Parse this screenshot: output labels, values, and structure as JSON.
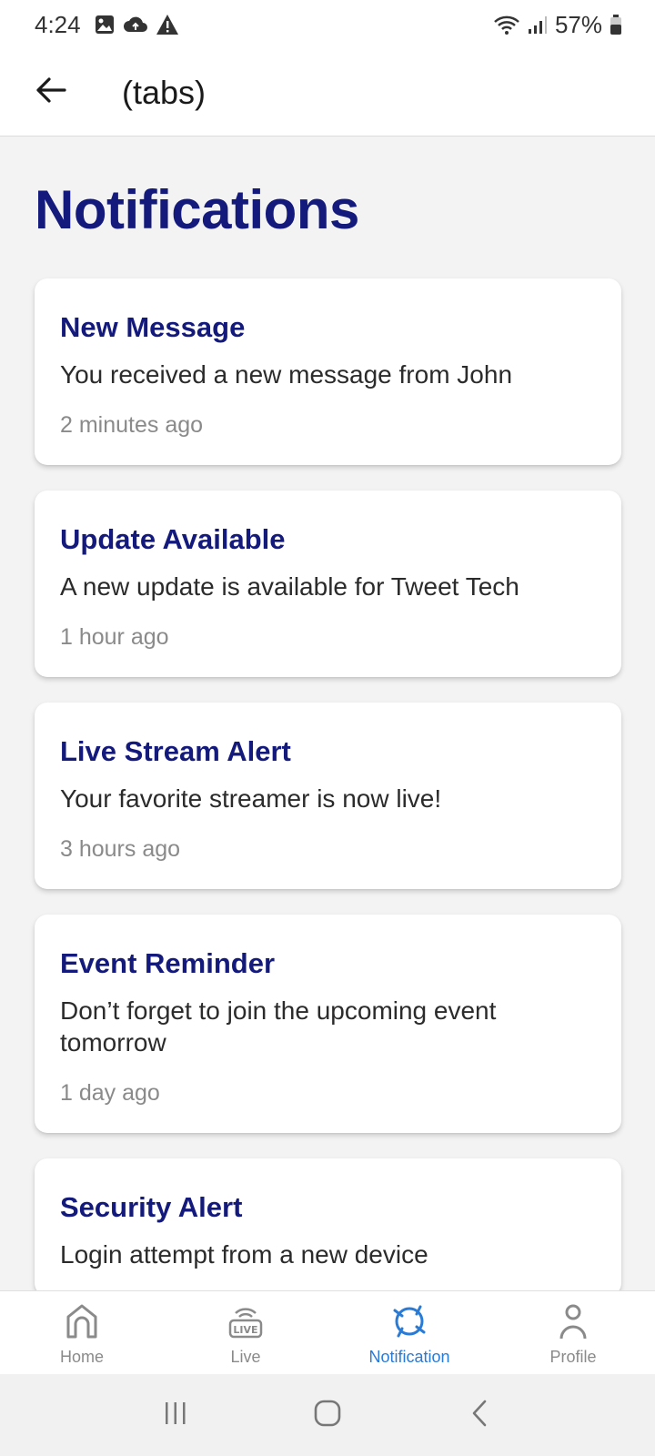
{
  "status_bar": {
    "time": "4:24",
    "battery": "57%",
    "icons_left": [
      "image-icon",
      "cloud-icon",
      "warning-icon"
    ],
    "icons_right": [
      "wifi-icon",
      "signal-icon",
      "battery-icon"
    ]
  },
  "app_bar": {
    "title": "(tabs)",
    "back_icon": "back-arrow-icon"
  },
  "page": {
    "title": "Notifications"
  },
  "notifications": [
    {
      "title": "New Message",
      "body": "You received a new message from John",
      "time": "2 minutes ago"
    },
    {
      "title": "Update Available",
      "body": "A new update is available for Tweet Tech",
      "time": "1 hour ago"
    },
    {
      "title": "Live Stream Alert",
      "body": "Your favorite streamer is now live!",
      "time": "3 hours ago"
    },
    {
      "title": "Event Reminder",
      "body": "Don’t forget to join the upcoming event tomorrow",
      "time": "1 day ago"
    },
    {
      "title": "Security Alert",
      "body": "Login attempt from a new device",
      "time": ""
    }
  ],
  "bottom_nav": {
    "active": "Notification",
    "items": [
      {
        "label": "Home",
        "icon": "home-icon"
      },
      {
        "label": "Live",
        "icon": "live-icon"
      },
      {
        "label": "Notification",
        "icon": "notification-icon"
      },
      {
        "label": "Profile",
        "icon": "profile-icon"
      }
    ]
  },
  "colors": {
    "accent": "#141a7c",
    "active_tab": "#2a7bd6",
    "background": "#f3f3f3",
    "muted_text": "#8a8a8a"
  }
}
